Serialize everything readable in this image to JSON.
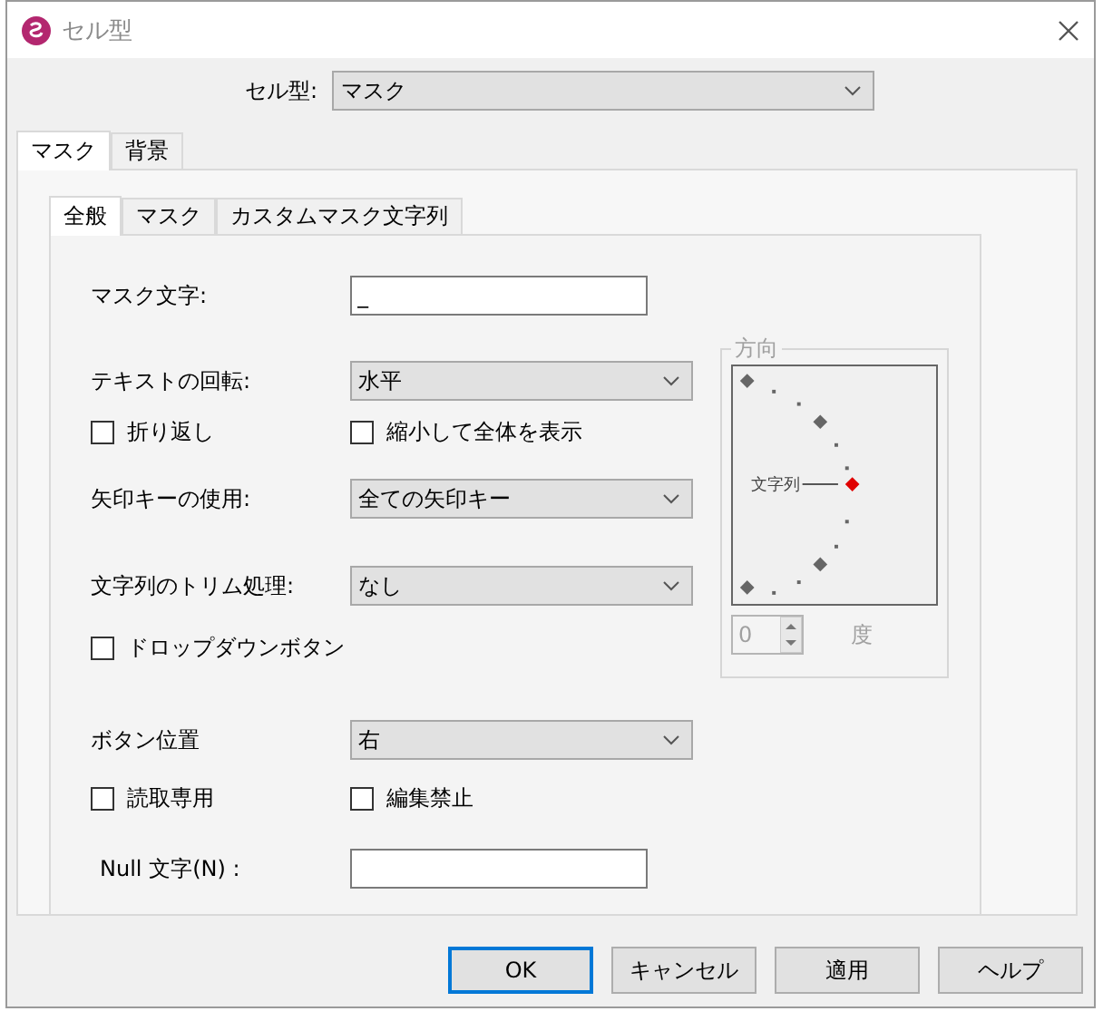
{
  "window": {
    "title": "セル型"
  },
  "cell_type": {
    "label": "セル型:",
    "value": "マスク"
  },
  "outer_tabs": [
    {
      "label": "マスク",
      "selected": true
    },
    {
      "label": "背景",
      "selected": false
    }
  ],
  "inner_tabs": [
    {
      "label": "全般",
      "selected": true
    },
    {
      "label": "マスク",
      "selected": false
    },
    {
      "label": "カスタムマスク文字列",
      "selected": false
    }
  ],
  "rows": [
    {
      "kind": "input",
      "label": "マスク文字:",
      "value": "_"
    },
    {
      "kind": "select",
      "label": "テキストの回転:",
      "value": "水平"
    },
    {
      "kind": "checks",
      "items": [
        {
          "label": "折り返し",
          "checked": false
        },
        {
          "label": "縮小して全体を表示",
          "checked": false
        }
      ]
    },
    {
      "kind": "select",
      "label": "矢印キーの使用:",
      "value": "全ての矢印キー"
    },
    {
      "kind": "select",
      "label": "文字列のトリム処理:",
      "value": "なし"
    },
    {
      "kind": "checks",
      "items": [
        {
          "label": "ドロップダウンボタン",
          "checked": false
        }
      ]
    },
    {
      "kind": "select",
      "label": "ボタン位置",
      "value": "右"
    },
    {
      "kind": "checks",
      "items": [
        {
          "label": "読取専用",
          "checked": false
        },
        {
          "label": "編集禁止",
          "checked": false
        }
      ]
    },
    {
      "kind": "input",
      "label": "Null 文字(N) :",
      "value": ""
    }
  ],
  "direction": {
    "title": "方向",
    "label": "文字列",
    "value": "0",
    "unit": "度",
    "disabled": true
  },
  "buttons": [
    {
      "label": "OK",
      "default": true
    },
    {
      "label": "キャンセル",
      "default": false
    },
    {
      "label": "適用",
      "default": false
    },
    {
      "label": "ヘルプ",
      "default": false
    }
  ]
}
